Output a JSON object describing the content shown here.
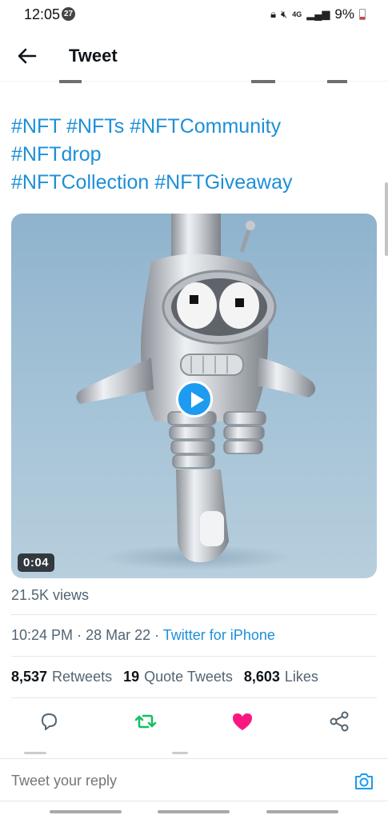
{
  "status_bar": {
    "time": "12:05",
    "notification_count": "27",
    "network": "4G",
    "battery": "9%"
  },
  "header": {
    "title": "Tweet"
  },
  "tweet": {
    "hashtags": [
      "#NFT",
      "#NFTs",
      "#NFTCommunity",
      "#NFTdrop",
      "#NFTCollection",
      "#NFTGiveaway"
    ],
    "media": {
      "duration": "0:04"
    },
    "views": "21.5K views",
    "time": "10:24 PM",
    "date": "28 Mar 22",
    "source": "Twitter for iPhone",
    "stats": {
      "retweets_count": "8,537",
      "retweets_label": "Retweets",
      "quote_count": "19",
      "quote_label": "Quote Tweets",
      "likes_count": "8,603",
      "likes_label": "Likes"
    }
  },
  "actions": {
    "reply_icon": "comment-icon",
    "retweet_icon": "retweet-icon",
    "like_icon": "heart-icon",
    "share_icon": "share-icon",
    "retweet_color": "#17bf63",
    "like_color": "#f91880"
  },
  "reply_bar": {
    "placeholder": "Tweet your reply"
  },
  "colors": {
    "accent": "#1d9bf0",
    "hashtag": "#1d8fd8",
    "secondary_text": "#536471"
  }
}
